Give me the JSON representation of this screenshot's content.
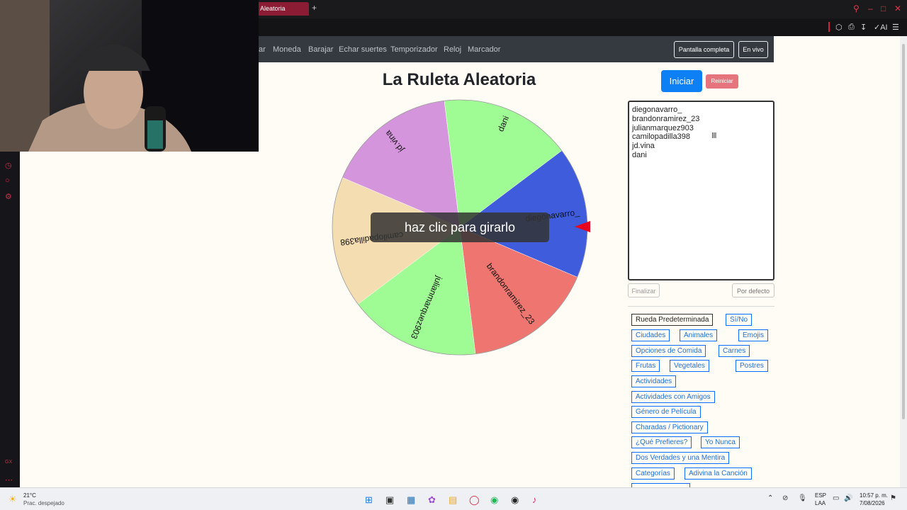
{
  "browser": {
    "active_tab_title": "Aleatoria",
    "new_tab_symbol": "+",
    "toolbar_ai": "AI"
  },
  "nav": {
    "links": [
      "ar",
      "Moneda",
      "Barajar",
      "Echar suertes",
      "Temporizador",
      "Reloj",
      "Marcador"
    ],
    "fullscreen_label": "Pantalla completa",
    "live_label": "En vivo"
  },
  "title": "La Ruleta Aleatoria",
  "wheel": {
    "hint": "haz clic para girarlo",
    "segments": [
      {
        "label": "diegonavarro_",
        "color": "#3e5cdc"
      },
      {
        "label": "brandonramirez_23",
        "color": "#ef7670"
      },
      {
        "label": "julianmarquez903",
        "color": "#9ffb93"
      },
      {
        "label": "camilopadilla398",
        "color": "#f4ddb0"
      },
      {
        "label": "jd.vina",
        "color": "#d595dc"
      },
      {
        "label": "dani",
        "color": "#9ffb93"
      }
    ]
  },
  "controls": {
    "start_label": "Iniciar",
    "reset_label": "Reiniciar",
    "finish_label": "Finalizar",
    "default_label": "Por defecto"
  },
  "names": [
    "diegonavarro_",
    "brandonramirez_23",
    "julianmarquez903",
    "camilopadilla398",
    "jd.vina",
    "dani"
  ],
  "presets": [
    "Rueda Predeterminada",
    "Sí/No",
    "Ciudades",
    "Animales",
    "Emojis",
    "Opciones de Comida",
    "Carnes",
    "Frutas",
    "Vegetales",
    "Postres",
    "Actividades",
    "Actividades con Amigos",
    "Género de Película",
    "Charadas / Pictionary",
    "¿Qué Prefieres?",
    "Yo Nunca",
    "Dos Verdades y una Mentira",
    "Categorías",
    "Adivina la Canción"
  ],
  "taskbar": {
    "temperature": "21°C",
    "weather": "Prac. despejado",
    "lang_top": "ESP",
    "lang_bottom": "LAA",
    "time": "10:57 p. m.",
    "date": "7/08/2026"
  }
}
